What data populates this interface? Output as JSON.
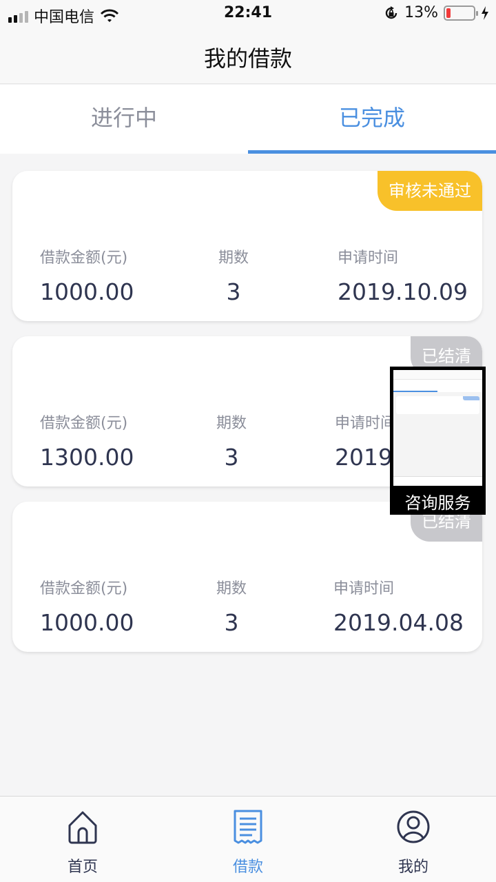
{
  "status_bar": {
    "carrier": "中国电信",
    "time": "22:41",
    "battery": "13%"
  },
  "header": {
    "title": "我的借款"
  },
  "tabs": [
    {
      "label": "进行中",
      "active": false
    },
    {
      "label": "已完成",
      "active": true
    }
  ],
  "loans": [
    {
      "status": "审核未通过",
      "status_color": "#f8c12a",
      "amount_label": "借款金额(元)",
      "amount": "1000.00",
      "periods_label": "期数",
      "periods": "3",
      "date_label": "申请时间",
      "date": "2019.10.09"
    },
    {
      "status": "已结清",
      "status_color": "#c8c8cc",
      "amount_label": "借款金额(元)",
      "amount": "1300.00",
      "periods_label": "期数",
      "periods": "3",
      "date_label": "申请时间",
      "date": "2019."
    },
    {
      "status": "已结清",
      "status_color": "#c8c8cc",
      "amount_label": "借款金额(元)",
      "amount": "1000.00",
      "periods_label": "期数",
      "periods": "3",
      "date_label": "申请时间",
      "date": "2019.04.08"
    }
  ],
  "consult": {
    "label": "咨询服务"
  },
  "tabbar": [
    {
      "label": "首页",
      "icon": "home-icon",
      "active": false
    },
    {
      "label": "借款",
      "icon": "receipt-icon",
      "active": true
    },
    {
      "label": "我的",
      "icon": "user-icon",
      "active": false
    }
  ],
  "colors": {
    "accent": "#4a8fe0",
    "warning": "#f8c12a",
    "settled": "#c8c8cc",
    "text": "#2f3550"
  }
}
